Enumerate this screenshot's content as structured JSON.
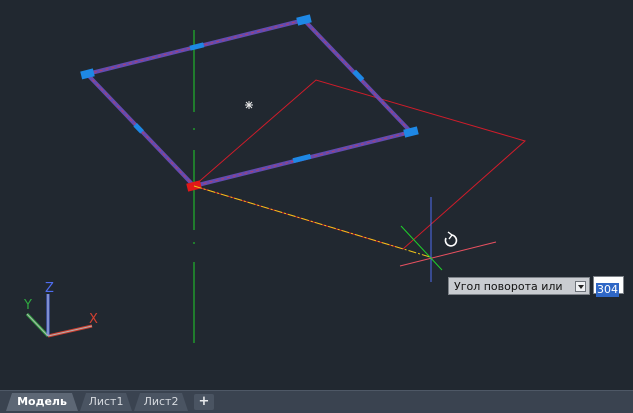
{
  "tooltip": {
    "prompt_label": "Угол поворота или",
    "value": "304"
  },
  "tabs": [
    {
      "label": "Модель",
      "active": true
    },
    {
      "label": "Лист1",
      "active": false
    },
    {
      "label": "Лист2",
      "active": false
    }
  ],
  "add_tab_label": "+",
  "ucs_icon": {
    "x_label": "X",
    "y_label": "Y",
    "z_label": "Z"
  },
  "colors": {
    "background": "#212830",
    "selected_rectangle": "#7a4cc4",
    "grip": "#1e88e5",
    "preview_rectangle": "#d01c2a",
    "rubber_band": "#f0c419",
    "axis_green": "#1fd12a",
    "axis_blue": "#4f6df0",
    "axis_red": "#e85060"
  },
  "icons": {
    "crosshair": "crosshair-cursor-icon",
    "rotate": "rotate-icon",
    "center_marker": "asterisk-marker-icon",
    "ucs": "ucs-icon"
  }
}
